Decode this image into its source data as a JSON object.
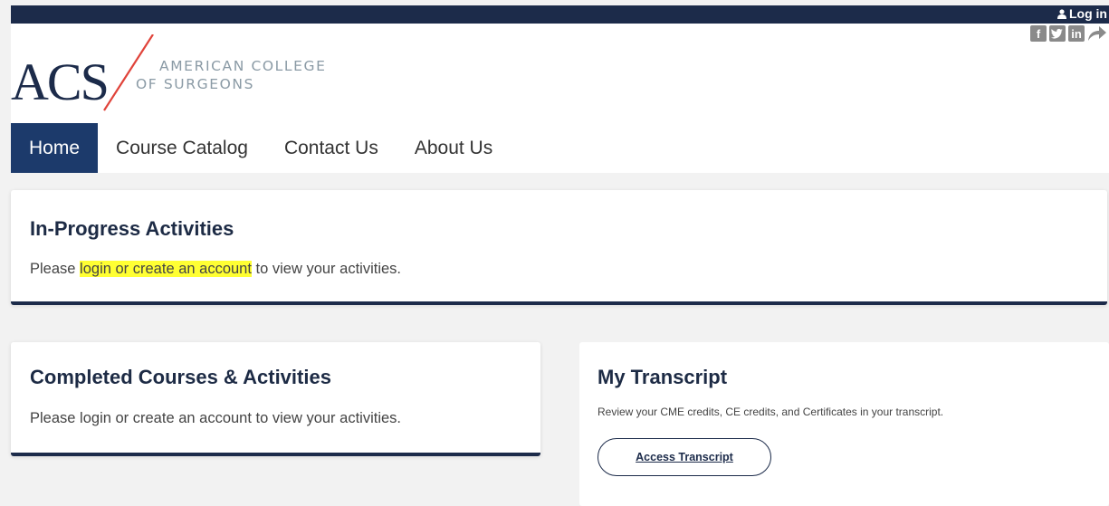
{
  "header": {
    "login_label": "Log in",
    "social_icons": [
      "facebook-icon",
      "twitter-icon",
      "linkedin-icon",
      "share-icon"
    ],
    "social_glyphs": {
      "facebook": "f",
      "twitter": "t",
      "linkedin": "in"
    }
  },
  "logo": {
    "acronym": "ACS",
    "line1": "AMERICAN COLLEGE",
    "line2": "OF SURGEONS"
  },
  "nav": {
    "items": [
      "Home",
      "Course Catalog",
      "Contact Us",
      "About Us"
    ],
    "active": "Home"
  },
  "in_progress": {
    "title": "In-Progress Activities",
    "text_before": "Please ",
    "login_link": "login",
    "or_text": " or ",
    "create_link": "create an account",
    "text_after": " to view your activities."
  },
  "completed": {
    "title": "Completed Courses & Activities",
    "text_before": "Please ",
    "login_link": "login",
    "or_text": " or ",
    "create_link": "create an account",
    "text_after": " to view your activities."
  },
  "transcript": {
    "title": "My Transcript",
    "description": "Review your CME credits, CE credits, and Certificates in your transcript.",
    "button_label": "Access Transcript"
  },
  "colors": {
    "navy": "#1c2b4a",
    "nav_active": "#1c3a6b",
    "highlight": "#ffff33",
    "logo_red": "#e0433a",
    "logo_gray": "#8a9aa5"
  }
}
